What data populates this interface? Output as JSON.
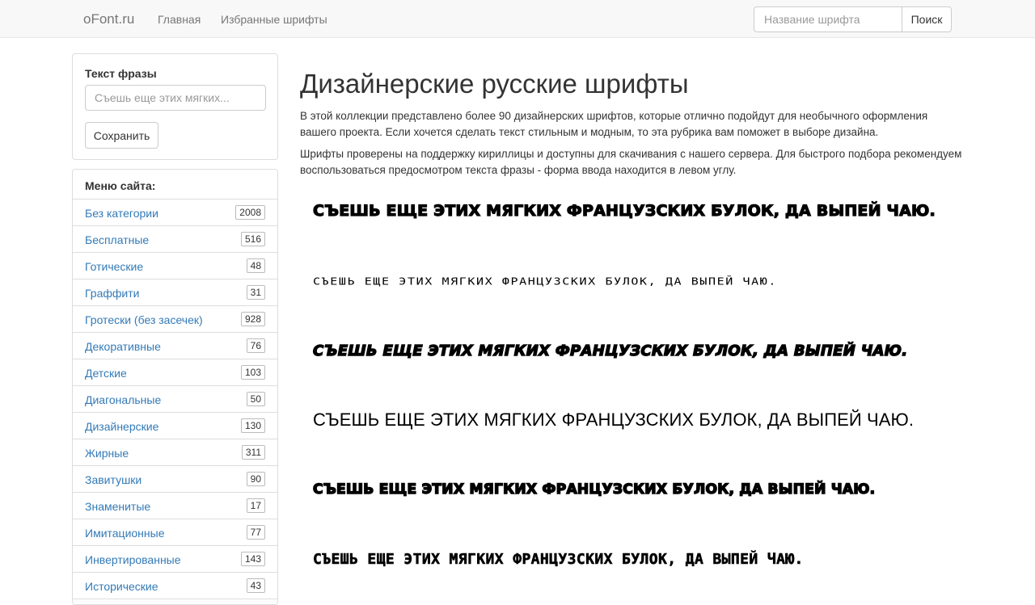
{
  "navbar": {
    "brand": "oFont.ru",
    "links": [
      "Главная",
      "Избранные шрифты"
    ],
    "search_placeholder": "Название шрифта",
    "search_button": "Поиск"
  },
  "phrase_panel": {
    "label": "Текст фразы",
    "placeholder": "Съешь еще этих мягких...",
    "save_button": "Сохранить"
  },
  "menu": {
    "title": "Меню сайта:",
    "items": [
      {
        "label": "Без категории",
        "count": "2008"
      },
      {
        "label": "Бесплатные",
        "count": "516"
      },
      {
        "label": "Готические",
        "count": "48"
      },
      {
        "label": "Граффити",
        "count": "31"
      },
      {
        "label": "Гротески (без засечек)",
        "count": "928"
      },
      {
        "label": "Декоративные",
        "count": "76"
      },
      {
        "label": "Детские",
        "count": "103"
      },
      {
        "label": "Диагональные",
        "count": "50"
      },
      {
        "label": "Дизайнерские",
        "count": "130"
      },
      {
        "label": "Жирные",
        "count": "311"
      },
      {
        "label": "Завитушки",
        "count": "90"
      },
      {
        "label": "Знаменитые",
        "count": "17"
      },
      {
        "label": "Имитационные",
        "count": "77"
      },
      {
        "label": "Инвертированные",
        "count": "143"
      },
      {
        "label": "Исторические",
        "count": "43"
      }
    ]
  },
  "main": {
    "title": "Дизайнерские русские шрифты",
    "paragraphs": [
      "В этой коллекции представлено более 90 дизайнерских шрифтов, которые отлично подойдут для необычного оформления вашего проекта. Если хочется сделать текст стильным и модным, то эта рубрика вам поможет в выборе дизайна.",
      "Шрифты проверены на поддержку кириллицы и доступны для скачивания с нашего сервера. Для быстрого подбора рекомендуем воспользоваться предосмотром текста фразы - форма ввода находится в левом углу."
    ],
    "samples": [
      "Съешь еще этих мягких французских булок, да выпей чаю.",
      "Съешь еще этих мягких французских булок, да выпей чаю.",
      "Съешь еще этих мягких французских булок, да выпей чаю.",
      "Съешь еще этих мягких французских булок, да выпей чаю.",
      "Съешь еще этих мягких французских булок, да выпей чаю.",
      "Съешь еще этих мягких французских булок, да выпей чаю."
    ]
  }
}
